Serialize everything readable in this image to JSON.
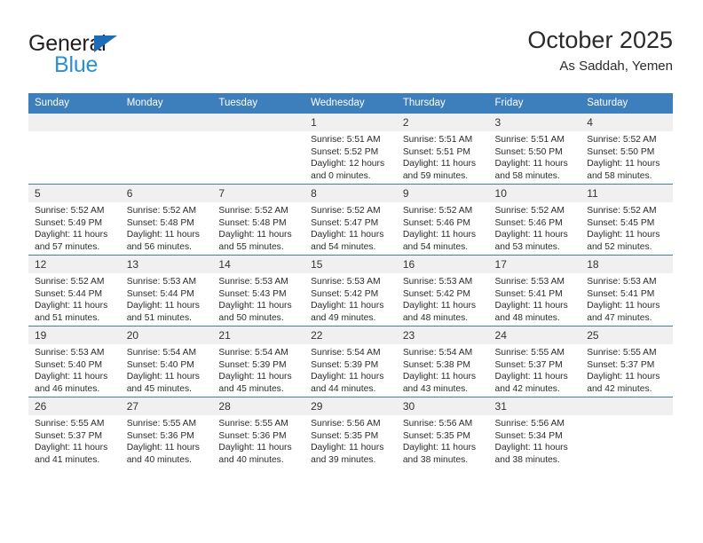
{
  "brand": {
    "name_part1": "General",
    "name_part2": "Blue",
    "accent_color": "#2b8fd4",
    "triangle_color": "#1d6cb5"
  },
  "header": {
    "title": "October 2025",
    "location": "As Saddah, Yemen"
  },
  "calendar": {
    "header_bg": "#3d7ebd",
    "daynum_bg": "#f0f0f0",
    "weekdays": [
      "Sunday",
      "Monday",
      "Tuesday",
      "Wednesday",
      "Thursday",
      "Friday",
      "Saturday"
    ],
    "weeks": [
      [
        {
          "day": "",
          "sunrise": "",
          "sunset": "",
          "daylight_line1": "",
          "daylight_line2": ""
        },
        {
          "day": "",
          "sunrise": "",
          "sunset": "",
          "daylight_line1": "",
          "daylight_line2": ""
        },
        {
          "day": "",
          "sunrise": "",
          "sunset": "",
          "daylight_line1": "",
          "daylight_line2": ""
        },
        {
          "day": "1",
          "sunrise": "Sunrise: 5:51 AM",
          "sunset": "Sunset: 5:52 PM",
          "daylight_line1": "Daylight: 12 hours",
          "daylight_line2": "and 0 minutes."
        },
        {
          "day": "2",
          "sunrise": "Sunrise: 5:51 AM",
          "sunset": "Sunset: 5:51 PM",
          "daylight_line1": "Daylight: 11 hours",
          "daylight_line2": "and 59 minutes."
        },
        {
          "day": "3",
          "sunrise": "Sunrise: 5:51 AM",
          "sunset": "Sunset: 5:50 PM",
          "daylight_line1": "Daylight: 11 hours",
          "daylight_line2": "and 58 minutes."
        },
        {
          "day": "4",
          "sunrise": "Sunrise: 5:52 AM",
          "sunset": "Sunset: 5:50 PM",
          "daylight_line1": "Daylight: 11 hours",
          "daylight_line2": "and 58 minutes."
        }
      ],
      [
        {
          "day": "5",
          "sunrise": "Sunrise: 5:52 AM",
          "sunset": "Sunset: 5:49 PM",
          "daylight_line1": "Daylight: 11 hours",
          "daylight_line2": "and 57 minutes."
        },
        {
          "day": "6",
          "sunrise": "Sunrise: 5:52 AM",
          "sunset": "Sunset: 5:48 PM",
          "daylight_line1": "Daylight: 11 hours",
          "daylight_line2": "and 56 minutes."
        },
        {
          "day": "7",
          "sunrise": "Sunrise: 5:52 AM",
          "sunset": "Sunset: 5:48 PM",
          "daylight_line1": "Daylight: 11 hours",
          "daylight_line2": "and 55 minutes."
        },
        {
          "day": "8",
          "sunrise": "Sunrise: 5:52 AM",
          "sunset": "Sunset: 5:47 PM",
          "daylight_line1": "Daylight: 11 hours",
          "daylight_line2": "and 54 minutes."
        },
        {
          "day": "9",
          "sunrise": "Sunrise: 5:52 AM",
          "sunset": "Sunset: 5:46 PM",
          "daylight_line1": "Daylight: 11 hours",
          "daylight_line2": "and 54 minutes."
        },
        {
          "day": "10",
          "sunrise": "Sunrise: 5:52 AM",
          "sunset": "Sunset: 5:46 PM",
          "daylight_line1": "Daylight: 11 hours",
          "daylight_line2": "and 53 minutes."
        },
        {
          "day": "11",
          "sunrise": "Sunrise: 5:52 AM",
          "sunset": "Sunset: 5:45 PM",
          "daylight_line1": "Daylight: 11 hours",
          "daylight_line2": "and 52 minutes."
        }
      ],
      [
        {
          "day": "12",
          "sunrise": "Sunrise: 5:52 AM",
          "sunset": "Sunset: 5:44 PM",
          "daylight_line1": "Daylight: 11 hours",
          "daylight_line2": "and 51 minutes."
        },
        {
          "day": "13",
          "sunrise": "Sunrise: 5:53 AM",
          "sunset": "Sunset: 5:44 PM",
          "daylight_line1": "Daylight: 11 hours",
          "daylight_line2": "and 51 minutes."
        },
        {
          "day": "14",
          "sunrise": "Sunrise: 5:53 AM",
          "sunset": "Sunset: 5:43 PM",
          "daylight_line1": "Daylight: 11 hours",
          "daylight_line2": "and 50 minutes."
        },
        {
          "day": "15",
          "sunrise": "Sunrise: 5:53 AM",
          "sunset": "Sunset: 5:42 PM",
          "daylight_line1": "Daylight: 11 hours",
          "daylight_line2": "and 49 minutes."
        },
        {
          "day": "16",
          "sunrise": "Sunrise: 5:53 AM",
          "sunset": "Sunset: 5:42 PM",
          "daylight_line1": "Daylight: 11 hours",
          "daylight_line2": "and 48 minutes."
        },
        {
          "day": "17",
          "sunrise": "Sunrise: 5:53 AM",
          "sunset": "Sunset: 5:41 PM",
          "daylight_line1": "Daylight: 11 hours",
          "daylight_line2": "and 48 minutes."
        },
        {
          "day": "18",
          "sunrise": "Sunrise: 5:53 AM",
          "sunset": "Sunset: 5:41 PM",
          "daylight_line1": "Daylight: 11 hours",
          "daylight_line2": "and 47 minutes."
        }
      ],
      [
        {
          "day": "19",
          "sunrise": "Sunrise: 5:53 AM",
          "sunset": "Sunset: 5:40 PM",
          "daylight_line1": "Daylight: 11 hours",
          "daylight_line2": "and 46 minutes."
        },
        {
          "day": "20",
          "sunrise": "Sunrise: 5:54 AM",
          "sunset": "Sunset: 5:40 PM",
          "daylight_line1": "Daylight: 11 hours",
          "daylight_line2": "and 45 minutes."
        },
        {
          "day": "21",
          "sunrise": "Sunrise: 5:54 AM",
          "sunset": "Sunset: 5:39 PM",
          "daylight_line1": "Daylight: 11 hours",
          "daylight_line2": "and 45 minutes."
        },
        {
          "day": "22",
          "sunrise": "Sunrise: 5:54 AM",
          "sunset": "Sunset: 5:39 PM",
          "daylight_line1": "Daylight: 11 hours",
          "daylight_line2": "and 44 minutes."
        },
        {
          "day": "23",
          "sunrise": "Sunrise: 5:54 AM",
          "sunset": "Sunset: 5:38 PM",
          "daylight_line1": "Daylight: 11 hours",
          "daylight_line2": "and 43 minutes."
        },
        {
          "day": "24",
          "sunrise": "Sunrise: 5:55 AM",
          "sunset": "Sunset: 5:37 PM",
          "daylight_line1": "Daylight: 11 hours",
          "daylight_line2": "and 42 minutes."
        },
        {
          "day": "25",
          "sunrise": "Sunrise: 5:55 AM",
          "sunset": "Sunset: 5:37 PM",
          "daylight_line1": "Daylight: 11 hours",
          "daylight_line2": "and 42 minutes."
        }
      ],
      [
        {
          "day": "26",
          "sunrise": "Sunrise: 5:55 AM",
          "sunset": "Sunset: 5:37 PM",
          "daylight_line1": "Daylight: 11 hours",
          "daylight_line2": "and 41 minutes."
        },
        {
          "day": "27",
          "sunrise": "Sunrise: 5:55 AM",
          "sunset": "Sunset: 5:36 PM",
          "daylight_line1": "Daylight: 11 hours",
          "daylight_line2": "and 40 minutes."
        },
        {
          "day": "28",
          "sunrise": "Sunrise: 5:55 AM",
          "sunset": "Sunset: 5:36 PM",
          "daylight_line1": "Daylight: 11 hours",
          "daylight_line2": "and 40 minutes."
        },
        {
          "day": "29",
          "sunrise": "Sunrise: 5:56 AM",
          "sunset": "Sunset: 5:35 PM",
          "daylight_line1": "Daylight: 11 hours",
          "daylight_line2": "and 39 minutes."
        },
        {
          "day": "30",
          "sunrise": "Sunrise: 5:56 AM",
          "sunset": "Sunset: 5:35 PM",
          "daylight_line1": "Daylight: 11 hours",
          "daylight_line2": "and 38 minutes."
        },
        {
          "day": "31",
          "sunrise": "Sunrise: 5:56 AM",
          "sunset": "Sunset: 5:34 PM",
          "daylight_line1": "Daylight: 11 hours",
          "daylight_line2": "and 38 minutes."
        },
        {
          "day": "",
          "sunrise": "",
          "sunset": "",
          "daylight_line1": "",
          "daylight_line2": ""
        }
      ]
    ]
  }
}
